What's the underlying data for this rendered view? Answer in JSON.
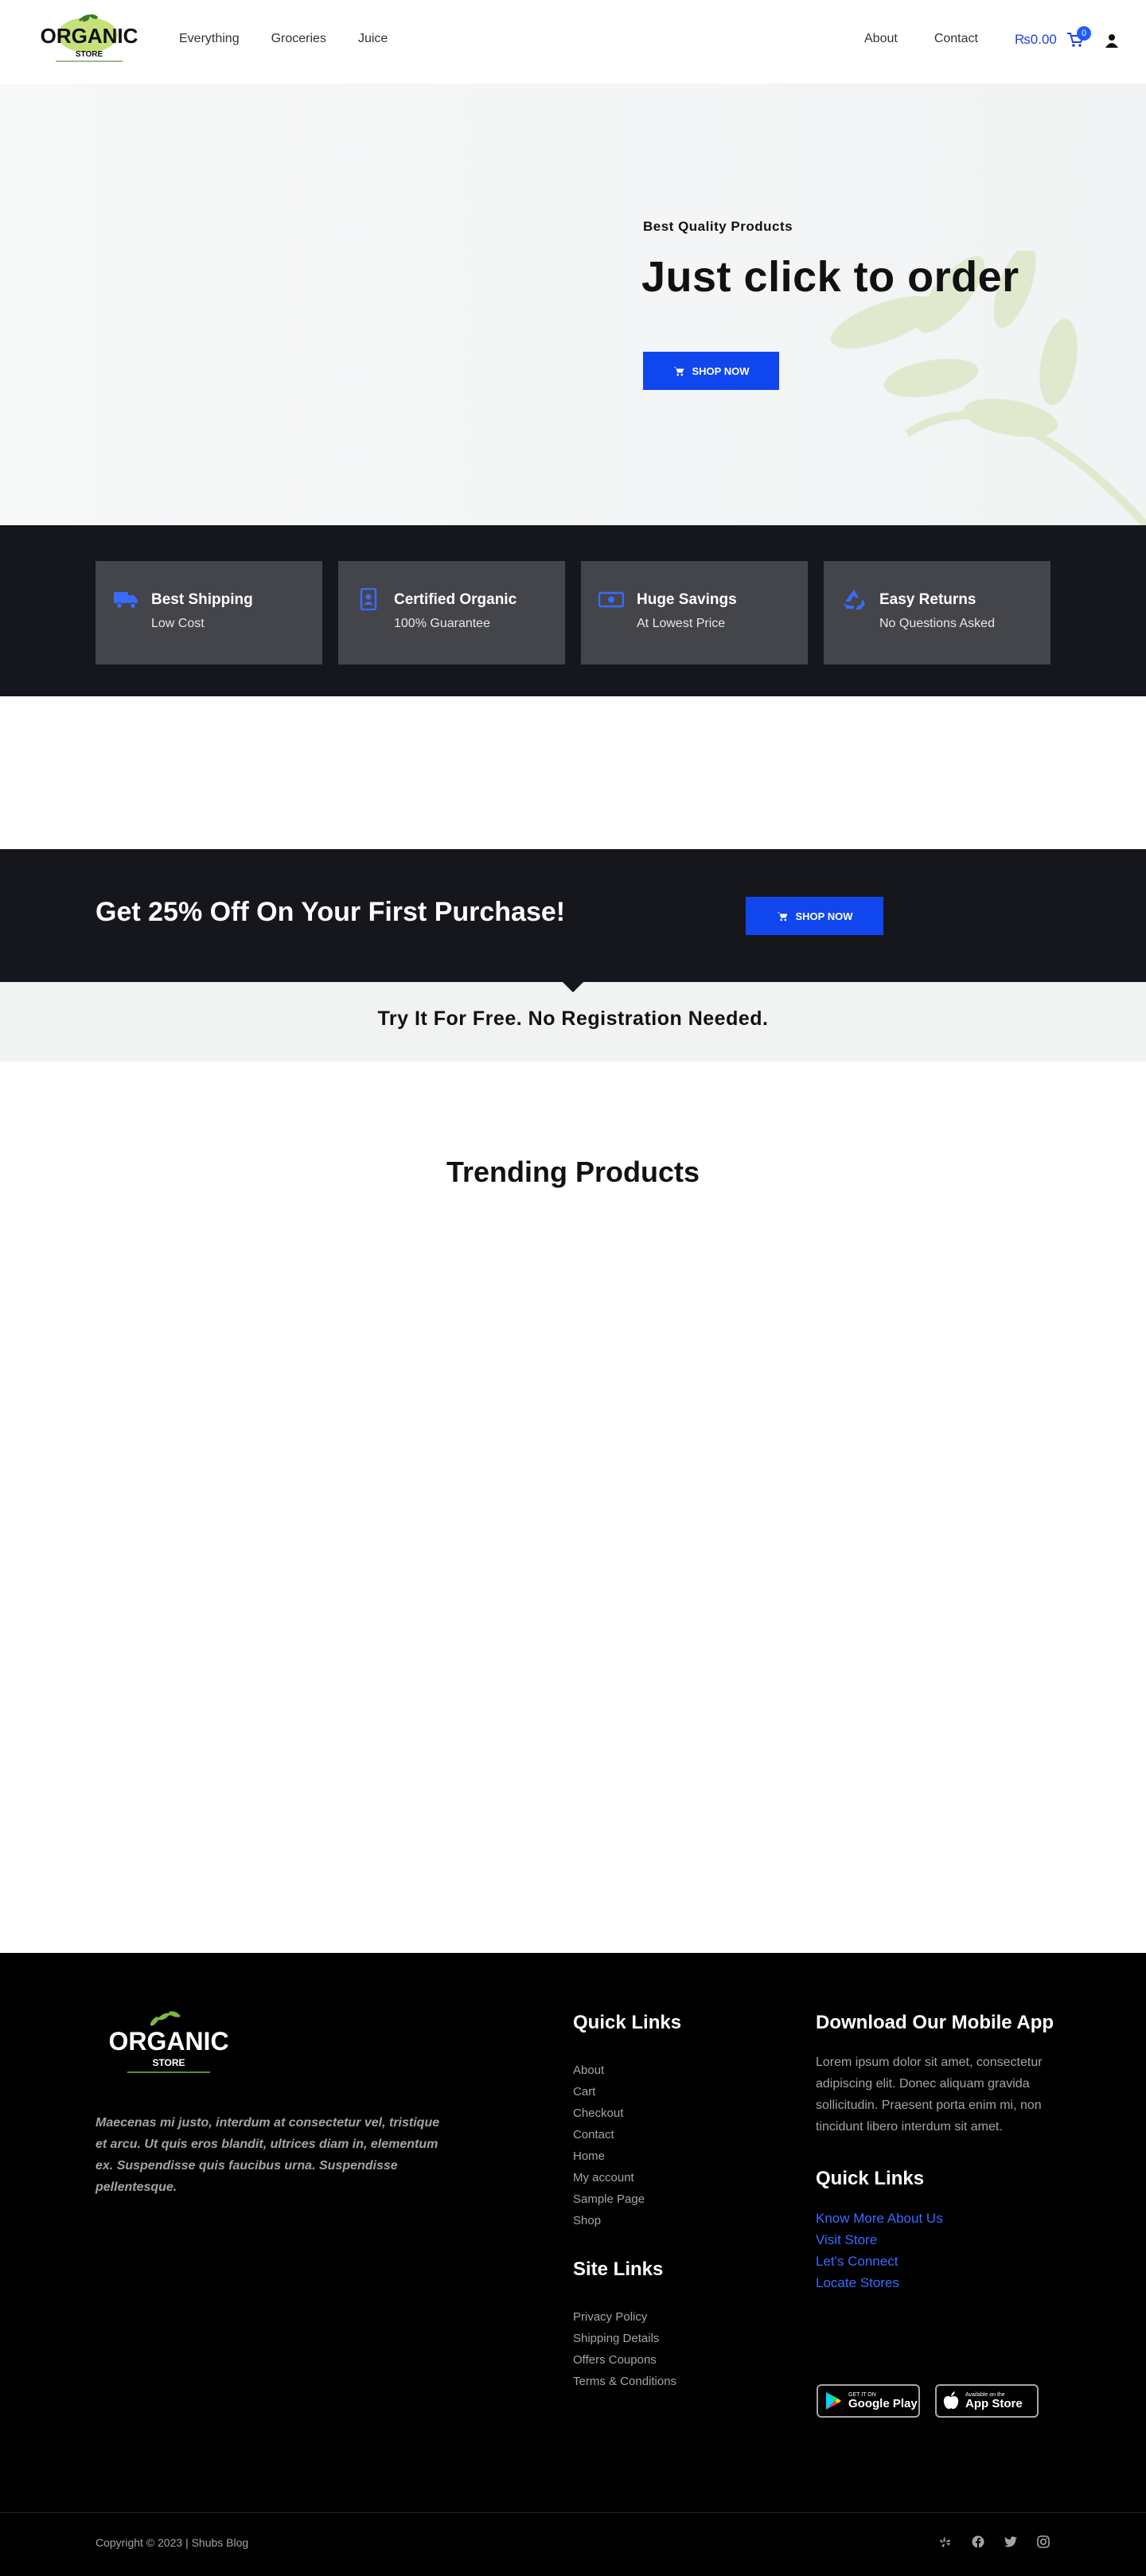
{
  "header": {
    "logo_text": "ORGANIC",
    "logo_sub": "STORE",
    "nav": [
      "Everything",
      "Groceries",
      "Juice"
    ],
    "nav_right": [
      "About",
      "Contact"
    ],
    "cart_total": "₨0.00",
    "cart_count": "0"
  },
  "hero": {
    "subtitle": "Best Quality Products",
    "title": "Just click to order",
    "button": "SHOP NOW"
  },
  "features": [
    {
      "icon": "truck-icon",
      "title": "Best Shipping",
      "subtitle": "Low Cost"
    },
    {
      "icon": "badge-icon",
      "title": "Certified Organic",
      "subtitle": "100% Guarantee"
    },
    {
      "icon": "money-icon",
      "title": "Huge Savings",
      "subtitle": "At Lowest Price"
    },
    {
      "icon": "recycle-icon",
      "title": "Easy Returns",
      "subtitle": "No Questions Asked"
    }
  ],
  "promo": {
    "title": "Get 25% Off On Your First Purchase!",
    "button": "SHOP NOW",
    "free_text": "Try It For Free. No Registration Needed."
  },
  "trending": {
    "title": "Trending Products"
  },
  "footer": {
    "about": "Maecenas mi justo, interdum at consectetur vel, tristique et arcu. Ut quis eros blandit, ultrices diam in, elementum ex. Suspendisse quis faucibus urna. Suspendisse pellentesque.",
    "quick_links_heading": "Quick Links",
    "quick_links": [
      "About",
      "Cart",
      "Checkout",
      "Contact",
      "Home",
      "My account",
      "Sample Page",
      "Shop"
    ],
    "site_links_heading": "Site Links",
    "site_links": [
      "Privacy Policy",
      "Shipping Details",
      "Offers Coupons",
      "Terms & Conditions"
    ],
    "app_heading": "Download Our Mobile App",
    "app_text": "Lorem ipsum dolor sit amet, consectetur adipiscing elit. Donec aliquam gravida sollicitudin. Praesent porta enim mi, non tincidunt libero interdum sit amet.",
    "quick_links2_heading": "Quick Links",
    "quick_links2": [
      "Know More About Us",
      "Visit Store",
      "Let's Connect",
      "Locate Stores"
    ],
    "google_play": {
      "small": "GET IT ON",
      "big": "Google Play"
    },
    "app_store": {
      "small": "Available on the",
      "big": "App Store"
    },
    "copyright": "Copyright © 2023 | Shubs Blog"
  },
  "colors": {
    "accent": "#1046ee",
    "dark": "#16171c",
    "card": "#44454a",
    "link": "#3a6bff"
  }
}
